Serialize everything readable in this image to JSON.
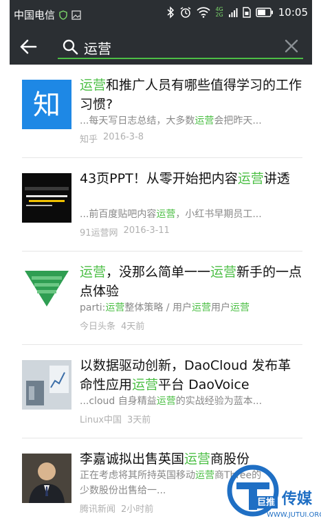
{
  "status": {
    "carrier": "中国电信",
    "time": "10:05",
    "net_top": "4G",
    "net_bottom": "2G"
  },
  "search": {
    "query": "运营"
  },
  "results": [
    {
      "title_parts": [
        "",
        "运营",
        "和推广人员有哪些值得学习的工作习惯?"
      ],
      "summary_parts": [
        "...每天写日志总结，大多数",
        "运营",
        "会把昨天..."
      ],
      "source": "知乎",
      "date": "2016-3-8",
      "thumb": "zhihu"
    },
    {
      "title_parts": [
        "43页PPT！从零开始把内容",
        "运营",
        "讲透"
      ],
      "summary_parts": [
        "...前百度贴吧内容",
        "运营",
        "，小红书早期员工..."
      ],
      "source": "91运营网",
      "date": "2016-3-11",
      "thumb": "ppt"
    },
    {
      "title_parts": [
        "",
        "运营",
        "，没那么简单一一",
        "运营",
        "新手的一点点体验"
      ],
      "summary_parts": [
        "parti:",
        "运营",
        "整体策略 / 用户",
        "运营",
        "用户",
        "运营",
        ""
      ],
      "source": "今日头条",
      "date": "4天前",
      "thumb": "funnel"
    },
    {
      "title_parts": [
        "以数据驱动创新，DaoCloud 发布革命性应用",
        "运营",
        "平台 DaoVoice"
      ],
      "summary_parts": [
        "...cloud 自身精益",
        "运营",
        "的实战经验为蓝本..."
      ],
      "source": "Linux中国",
      "date": "3天前",
      "thumb": "chart"
    },
    {
      "title_parts": [
        "李嘉诚拟出售英国",
        "运营",
        "商股份"
      ],
      "summary_parts": [
        "正在考虑将其所持英国移动",
        "运营",
        "商Three的"
      ],
      "summary2": "少数股份出售给一...",
      "source": "腾讯新闻",
      "date": "2小时前",
      "thumb": "person"
    }
  ],
  "watermark": {
    "brand_cn": "巨推",
    "brand_cn2": "传媒",
    "url": "WWW.JUTUI.ORG"
  },
  "colors": {
    "highlight": "#4cbf45",
    "bar": "#2b2f33"
  }
}
